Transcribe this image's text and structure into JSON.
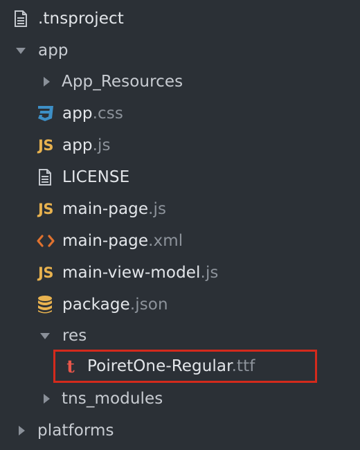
{
  "tree": {
    "tnsproject": {
      "name": ".tnsproject",
      "ext": "",
      "icon": "file-text-icon"
    },
    "app_folder": {
      "name": "app",
      "expanded": true
    },
    "app_resources": {
      "name": "App_Resources",
      "expanded": false
    },
    "app_css": {
      "base": "app",
      "ext": ".css",
      "icon": "css3-icon"
    },
    "app_js": {
      "base": "app",
      "ext": ".js",
      "icon": "js-icon",
      "icon_text": "JS"
    },
    "license": {
      "name": "LICENSE",
      "icon": "file-text-icon"
    },
    "main_page_js": {
      "base": "main-page",
      "ext": ".js",
      "icon": "js-icon",
      "icon_text": "JS"
    },
    "main_page_xml": {
      "base": "main-page",
      "ext": ".xml",
      "icon": "code-icon"
    },
    "main_view_model_js": {
      "base": "main-view-model",
      "ext": ".js",
      "icon": "js-icon",
      "icon_text": "JS"
    },
    "package_json": {
      "base": "package",
      "ext": ".json",
      "icon": "database-icon"
    },
    "res_folder": {
      "name": "res",
      "expanded": true
    },
    "font_file": {
      "base": "PoiretOne-Regular",
      "ext": ".ttf",
      "icon": "font-icon",
      "icon_text": "t",
      "highlighted": true
    },
    "tns_modules": {
      "name": "tns_modules",
      "expanded": false
    },
    "platforms": {
      "name": "platforms",
      "expanded": false
    }
  },
  "colors": {
    "background": "#2b3036",
    "text": "#e3e6ea",
    "ext_text": "#8d939b",
    "arrow": "#8a9099",
    "js_icon": "#e8b24f",
    "css_icon": "#3d8fc6",
    "xml_icon": "#e0722f",
    "font_icon": "#e8564a",
    "highlight": "#d42a1c"
  }
}
